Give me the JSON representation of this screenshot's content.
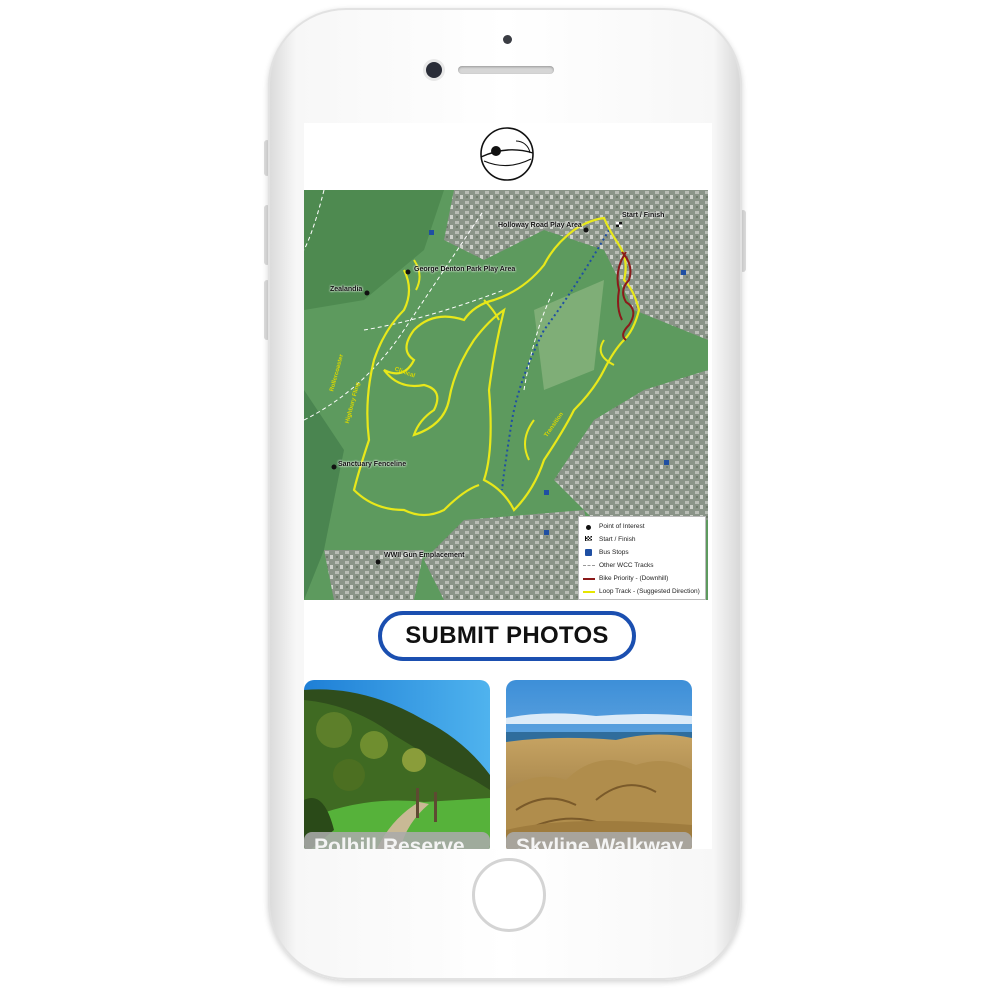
{
  "app": {
    "logo_icon": "circle-eye-logo-icon"
  },
  "map": {
    "labels": {
      "start_finish": "Start / Finish",
      "holloway": "Holloway Road Play Area",
      "george_denton": "George Denton Park Play Area",
      "zealandia": "Zealandia",
      "sanctuary": "Sanctuary Fenceline",
      "wwii": "WWII Gun Emplacement",
      "clinical": "Clinical",
      "highbury": "Highbury Fling",
      "rollercoaster": "Rollercoaster",
      "transition": "Transition"
    },
    "legend": [
      {
        "label": "Point of Interest",
        "symbol": "dot"
      },
      {
        "label": "Start / Finish",
        "symbol": "flag"
      },
      {
        "label": "Bus Stops",
        "symbol": "bus"
      },
      {
        "label": "Other WCC Tracks",
        "symbol": "line",
        "color": "#ffffff"
      },
      {
        "label": "Bike Priority - (Downhill)",
        "symbol": "line",
        "color": "#8b1a1a"
      },
      {
        "label": "Loop Track - (Suggested Direction)",
        "symbol": "line",
        "color": "#e6e600"
      }
    ],
    "colors": {
      "loop_track": "#e6e600",
      "bike_priority": "#8b1a1a",
      "blue_track": "#1f4fa3",
      "terrain": "#5f9e60"
    }
  },
  "submit": {
    "label": "SUBMIT PHOTOS",
    "border_color": "#1b4fb0"
  },
  "cards": [
    {
      "title": "Polhill Reserve"
    },
    {
      "title": "Skyline Walkway"
    }
  ]
}
